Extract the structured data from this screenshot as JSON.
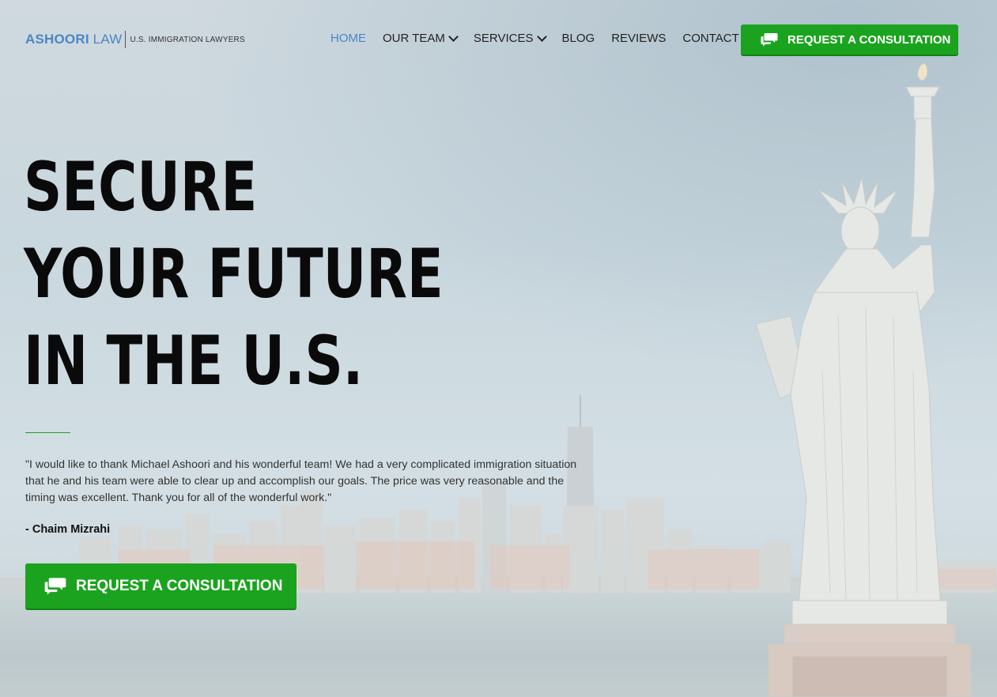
{
  "header": {
    "logo": {
      "name": "ASHOORI",
      "law": " LAW",
      "tagline": "U.S. IMMIGRATION LAWYERS"
    },
    "nav": [
      {
        "label": "HOME",
        "active": true,
        "dropdown": false
      },
      {
        "label": "OUR TEAM",
        "active": false,
        "dropdown": true
      },
      {
        "label": "SERVICES",
        "active": false,
        "dropdown": true
      },
      {
        "label": "BLOG",
        "active": false,
        "dropdown": false
      },
      {
        "label": "REVIEWS",
        "active": false,
        "dropdown": false
      },
      {
        "label": "CONTACT",
        "active": false,
        "dropdown": false
      }
    ],
    "cta_label": "REQUEST A CONSULTATION",
    "cta_icon": "chat-bubbles-icon"
  },
  "hero": {
    "headline": [
      "SECURE",
      "YOUR FUTURE",
      "IN THE U.S."
    ],
    "quote": "\"I would like to thank Michael Ashoori and his wonderful team! We had a very complicated immigration situation that he and his team were able to clear up and accomplish our goals. The price was very reasonable and the timing was excellent. Thank you for all of the wonderful work.\"",
    "author": "- Chaim Mizrahi",
    "cta_label": "REQUEST A CONSULTATION",
    "cta_icon": "chat-bubbles-icon"
  },
  "colors": {
    "brand_blue": "#4a86c5",
    "cta_green": "#1ba31f",
    "headline": "#0a0a0a"
  }
}
